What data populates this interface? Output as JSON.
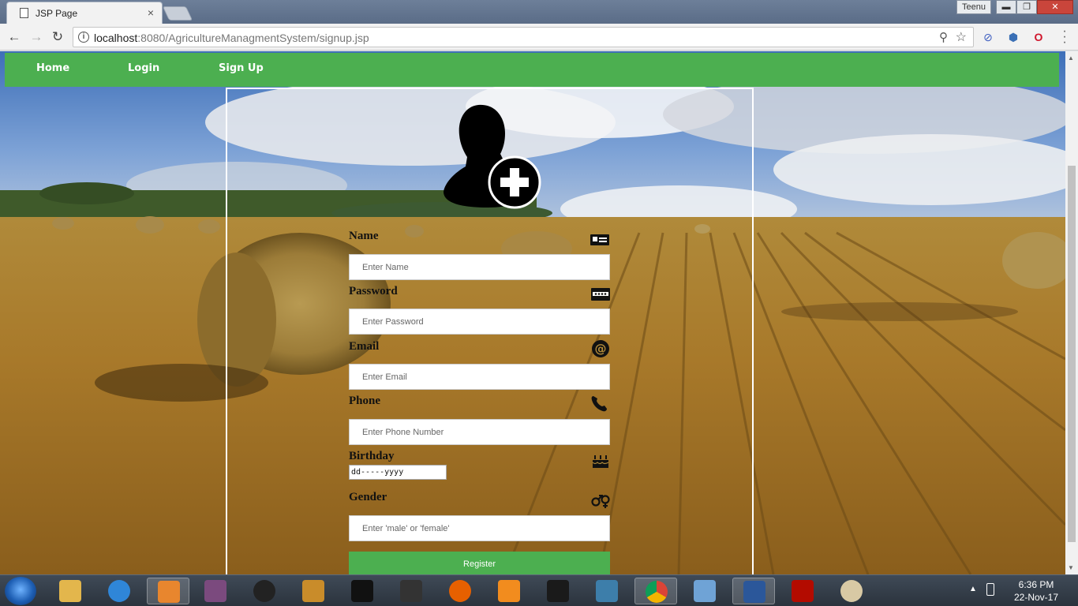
{
  "browser": {
    "tab_title": "JSP Page",
    "tab_close": "×",
    "window_user": "Teenu",
    "url_host": "localhost",
    "url_rest": ":8080/AgricultureManagmentSystem/signup.jsp",
    "win_min": "▬",
    "win_max": "❐",
    "win_close": "✕"
  },
  "nav": {
    "home": "Home",
    "login": "Login",
    "signup": "Sign Up"
  },
  "form": {
    "name_label": "Name",
    "name_placeholder": "Enter Name",
    "password_label": "Password",
    "password_placeholder": "Enter Password",
    "email_label": "Email",
    "email_placeholder": "Enter Email",
    "phone_label": "Phone",
    "phone_placeholder": "Enter Phone Number",
    "birthday_label": "Birthday",
    "birthday_value": "dd-----yyyy",
    "gender_label": "Gender",
    "gender_placeholder": "Enter 'male' or 'female'",
    "register_label": "Register"
  },
  "icons": {
    "name": "id-card-icon",
    "password": "password-card-icon",
    "email": "at-sign-icon",
    "phone": "phone-icon",
    "birthday": "cake-icon",
    "gender": "gender-icon",
    "avatar": "add-user-icon"
  },
  "colors": {
    "accent": "#4caf50",
    "panel_border": "#ffffff"
  },
  "taskbar": {
    "time": "6:36 PM",
    "date": "22-Nov-17"
  }
}
